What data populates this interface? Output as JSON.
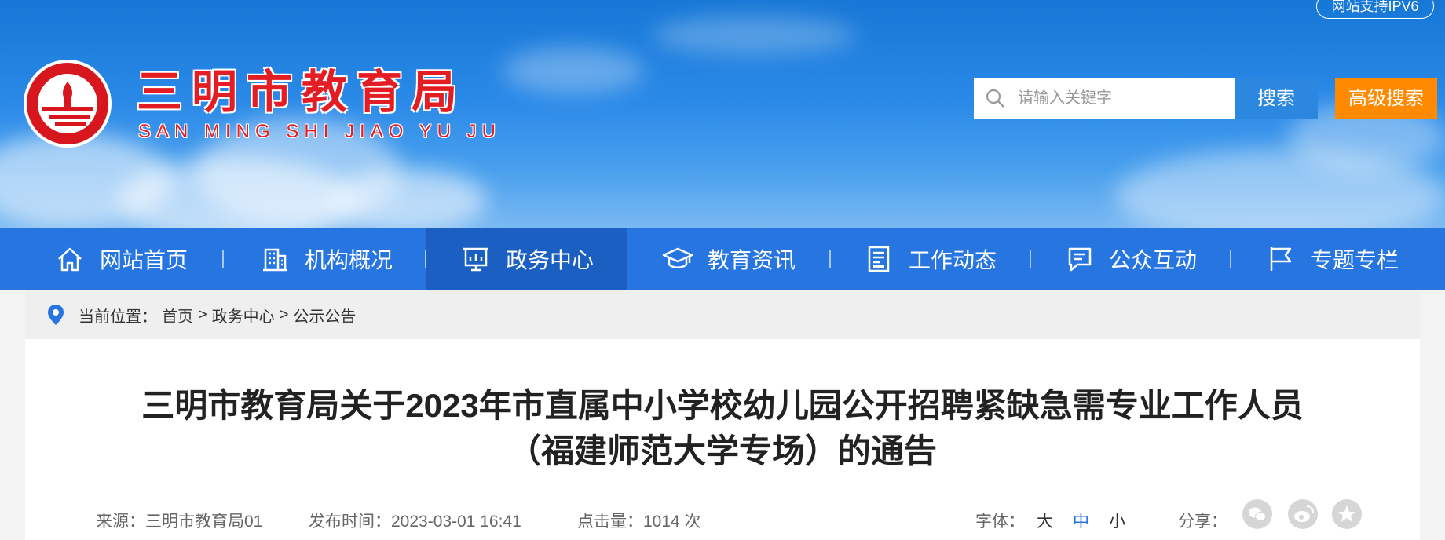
{
  "header": {
    "ipv6_badge": "网站支持IPV6",
    "title_cn": "三明市教育局",
    "title_en": "SAN MING SHI JIAO YU JU",
    "search_placeholder": "请输入关键字",
    "search_label": "搜索",
    "advanced_search_label": "高级搜索",
    "brand_red": "#e41c23"
  },
  "nav": {
    "items": [
      {
        "label": "网站首页",
        "icon": "home-icon"
      },
      {
        "label": "机构概况",
        "icon": "building-icon"
      },
      {
        "label": "政务中心",
        "icon": "presentation-icon",
        "active": true
      },
      {
        "label": "教育资讯",
        "icon": "graduation-cap-icon"
      },
      {
        "label": "工作动态",
        "icon": "document-icon"
      },
      {
        "label": "公众互动",
        "icon": "chat-icon"
      },
      {
        "label": "专题专栏",
        "icon": "flag-icon"
      }
    ],
    "bg_color": "#2675e0",
    "active_color": "#1b5fc2"
  },
  "breadcrumb": {
    "prefix": "当前位置：",
    "items": [
      "首页",
      "政务中心",
      "公示公告"
    ],
    "separator": ">"
  },
  "article": {
    "title_line1": "三明市教育局关于2023年市直属中小学校幼儿园公开招聘紧缺急需专业工作人员",
    "title_line2": "（福建师范大学专场）的通告",
    "source": "来源：三明市教育局01",
    "publish_time": "发布时间：2023-03-01 16:41",
    "views": "点击量：1014 次",
    "font_size_label": "字体：",
    "font_sizes": [
      "大",
      "中",
      "小"
    ],
    "share_label": "分享：",
    "share_icons": [
      "wechat-icon",
      "weibo-icon",
      "star-icon"
    ]
  }
}
